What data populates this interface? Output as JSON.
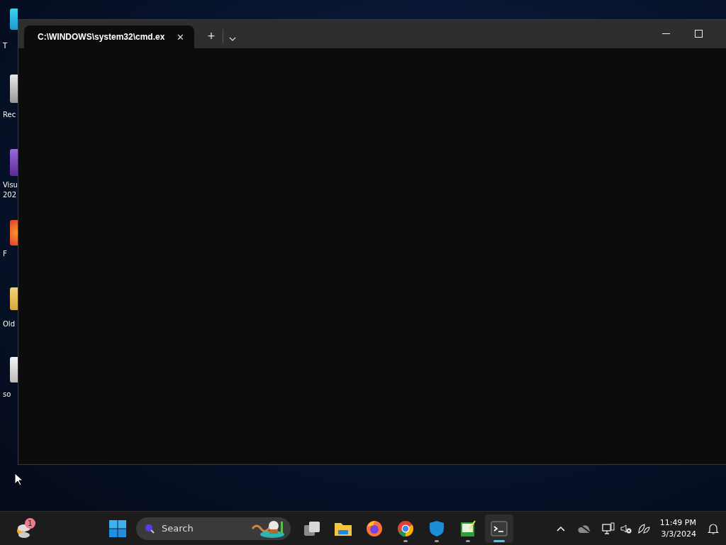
{
  "desktop_icons": [
    {
      "kind": "display",
      "lines": [
        "T"
      ]
    },
    {
      "kind": "bin",
      "lines": [
        "Rec"
      ]
    },
    {
      "kind": "vs",
      "lines": [
        "Visu",
        "202"
      ]
    },
    {
      "kind": "fox",
      "lines": [
        "F"
      ]
    },
    {
      "kind": "folder",
      "lines": [
        "Old"
      ]
    },
    {
      "kind": "file",
      "lines": [
        "so"
      ]
    }
  ],
  "window": {
    "tabs": [
      {
        "title": "C:\\WINDOWS\\system32\\cmd.ex",
        "selected": true,
        "close": "✕"
      }
    ],
    "new_tab": "+"
  },
  "taskbar": {
    "weather_badge": "1",
    "search": {
      "placeholder": "Search"
    },
    "apps": [
      {
        "kind": "task-view",
        "running": false,
        "active": false
      },
      {
        "kind": "folder",
        "running": false,
        "active": false
      },
      {
        "kind": "fox",
        "running": false,
        "active": false
      },
      {
        "kind": "chrome",
        "running": true,
        "active": false
      },
      {
        "kind": "shield",
        "running": true,
        "active": false
      },
      {
        "kind": "notepad",
        "running": true,
        "active": false
      },
      {
        "kind": "terminal",
        "running": true,
        "active": true
      }
    ],
    "clock": {
      "time": "11:49 PM",
      "date": "3/3/2024"
    }
  }
}
